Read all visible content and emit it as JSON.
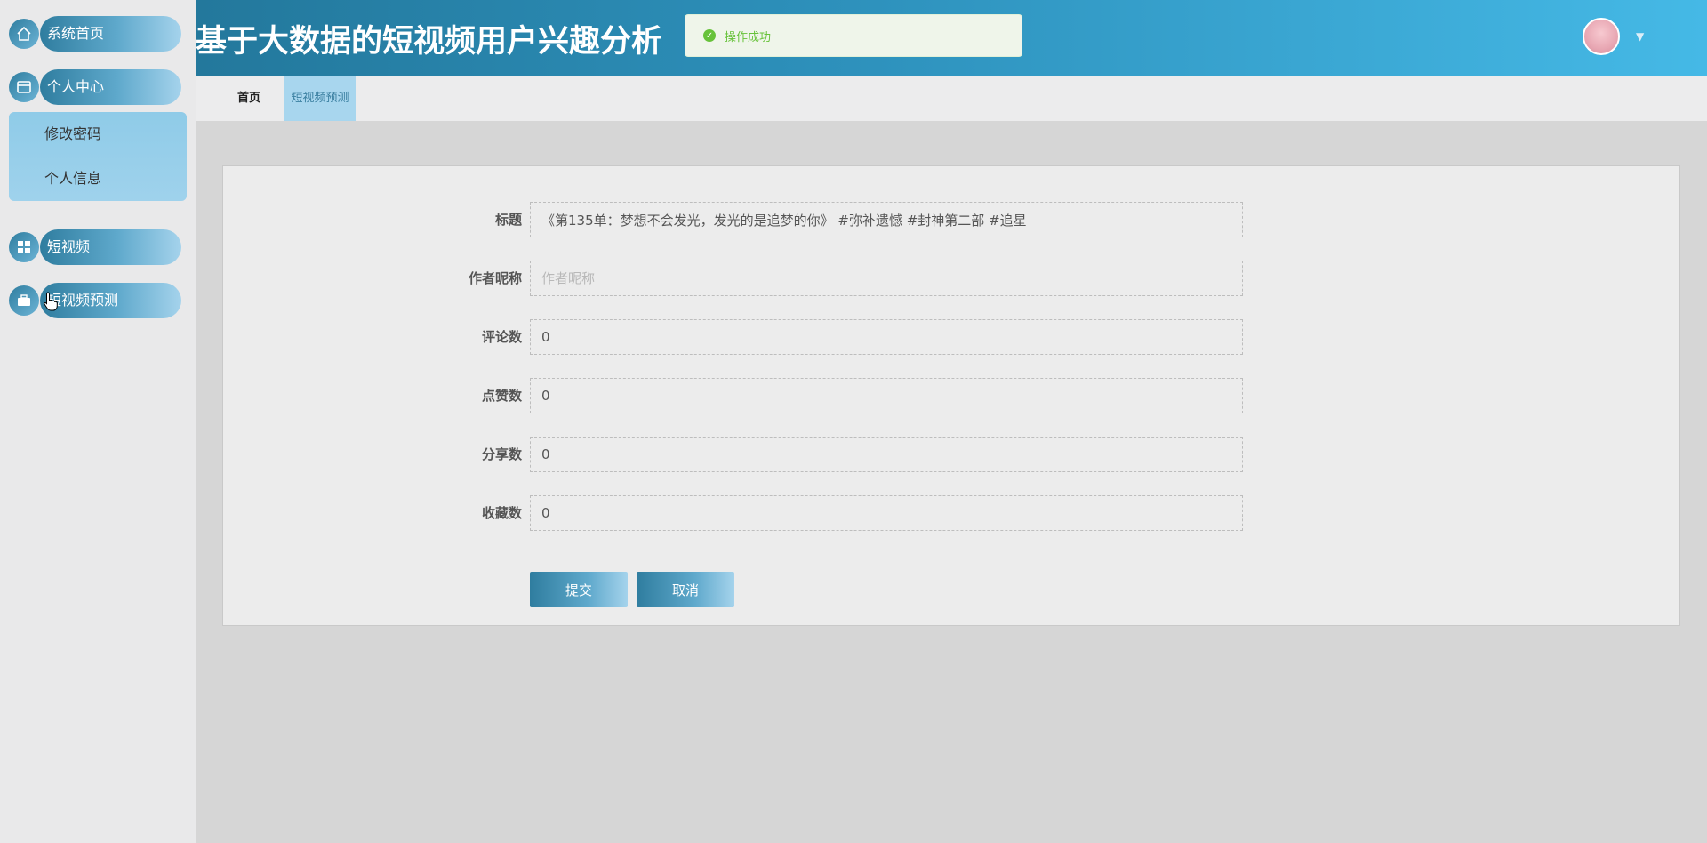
{
  "app": {
    "title": "基于大数据的短视频用户兴趣分析"
  },
  "toast": {
    "message": "操作成功",
    "icon": "check-circle-icon",
    "color": "#67c23a"
  },
  "sidebar": {
    "items": [
      {
        "label": "系统首页",
        "icon": "home-icon"
      },
      {
        "label": "个人中心",
        "icon": "user-card-icon"
      },
      {
        "label": "短视频",
        "icon": "grid-icon"
      },
      {
        "label": "短视频预测",
        "icon": "briefcase-icon"
      }
    ],
    "submenu": [
      {
        "label": "修改密码"
      },
      {
        "label": "个人信息"
      }
    ]
  },
  "tabs": [
    {
      "label": "首页"
    },
    {
      "label": "短视频预测"
    }
  ],
  "form": {
    "fields": [
      {
        "label": "标题",
        "value": "《第135单：梦想不会发光，发光的是追梦的你》 #弥补遗憾 #封神第二部 #追星",
        "placeholder": ""
      },
      {
        "label": "作者昵称",
        "value": "",
        "placeholder": "作者昵称"
      },
      {
        "label": "评论数",
        "value": "0",
        "placeholder": ""
      },
      {
        "label": "点赞数",
        "value": "0",
        "placeholder": ""
      },
      {
        "label": "分享数",
        "value": "0",
        "placeholder": ""
      },
      {
        "label": "收藏数",
        "value": "0",
        "placeholder": ""
      }
    ],
    "submit_label": "提交",
    "cancel_label": "取消"
  },
  "colors": {
    "header_start": "#23789c",
    "header_end": "#45b9e6",
    "accent": "#2f7d9f",
    "success": "#67c23a"
  }
}
